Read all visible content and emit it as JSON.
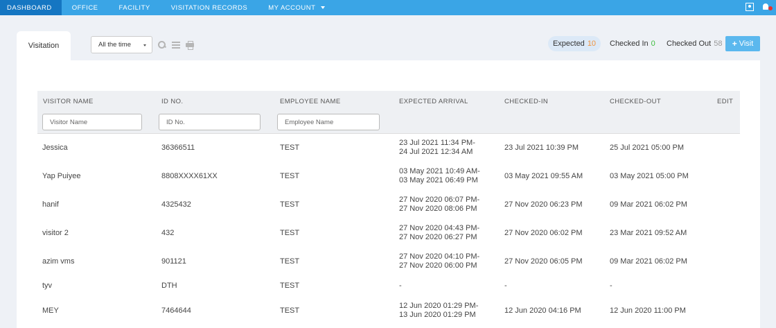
{
  "nav": {
    "items": [
      {
        "label": "DASHBOARD",
        "active": true
      },
      {
        "label": "OFFICE",
        "active": false
      },
      {
        "label": "FACILITY",
        "active": false
      },
      {
        "label": "VISITATION RECORDS",
        "active": false
      },
      {
        "label": "MY ACCOUNT",
        "active": false
      }
    ],
    "icons": [
      "contact-icon",
      "notification-bell-icon"
    ],
    "colors": {
      "bar": "#3aa5e6",
      "active": "#1576c2"
    }
  },
  "tab": {
    "label": "Visitation"
  },
  "filter": {
    "selected": "All the time"
  },
  "toolbar_icons": [
    "search-icon",
    "list-icon",
    "print-icon"
  ],
  "stats": {
    "expected": {
      "label": "Expected",
      "count": "10"
    },
    "checked_in": {
      "label": "Checked In",
      "count": "0"
    },
    "checked_out": {
      "label": "Checked Out",
      "count": "58"
    }
  },
  "visit_button": {
    "label": "Visit"
  },
  "table": {
    "headers": {
      "visitor_name": "VISITOR NAME",
      "id_no": "ID NO.",
      "employee_name": "EMPLOYEE NAME",
      "expected_arrival": "EXPECTED ARRIVAL",
      "checked_in": "CHECKED-IN",
      "checked_out": "CHECKED-OUT",
      "edit": "EDIT"
    },
    "filters": {
      "visitor_name": "Visitor Name",
      "id_no": "ID No.",
      "employee_name": "Employee Name"
    },
    "rows": [
      {
        "name": "Jessica",
        "id": "36366511",
        "employee": "TEST",
        "arrival_start": "23 Jul 2021 11:34 PM-",
        "arrival_end": "24 Jul 2021 12:34 AM",
        "checked_in": "23 Jul 2021 10:39 PM",
        "checked_out": "25 Jul 2021 05:00 PM"
      },
      {
        "name": "Yap Puiyee",
        "id": "8808XXXX61XX",
        "employee": "TEST",
        "arrival_start": "03 May 2021 10:49 AM-",
        "arrival_end": "03 May 2021 06:49 PM",
        "checked_in": "03 May 2021 09:55 AM",
        "checked_out": "03 May 2021 05:00 PM"
      },
      {
        "name": "hanif",
        "id": "4325432",
        "employee": "TEST",
        "arrival_start": "27 Nov 2020 06:07 PM-",
        "arrival_end": "27 Nov 2020 08:06 PM",
        "checked_in": "27 Nov 2020 06:23 PM",
        "checked_out": "09 Mar 2021 06:02 PM"
      },
      {
        "name": "visitor 2",
        "id": "432",
        "employee": "TEST",
        "arrival_start": "27 Nov 2020 04:43 PM-",
        "arrival_end": "27 Nov 2020 06:27 PM",
        "checked_in": "27 Nov 2020 06:02 PM",
        "checked_out": "23 Mar 2021 09:52 AM"
      },
      {
        "name": "azim vms",
        "id": "901121",
        "employee": "TEST",
        "arrival_start": "27 Nov 2020 04:10 PM-",
        "arrival_end": "27 Nov 2020 06:00 PM",
        "checked_in": "27 Nov 2020 06:05 PM",
        "checked_out": "09 Mar 2021 06:02 PM"
      },
      {
        "name": "tyv",
        "id": "DTH",
        "employee": "TEST",
        "arrival_start": "-",
        "arrival_end": "",
        "checked_in": "-",
        "checked_out": "-"
      },
      {
        "name": "MEY",
        "id": "7464644",
        "employee": "TEST",
        "arrival_start": "12 Jun 2020 01:29 PM-",
        "arrival_end": "13 Jun 2020 01:29 PM",
        "checked_in": "12 Jun 2020 04:16 PM",
        "checked_out": "12 Jun 2020 11:00 PM"
      }
    ]
  }
}
